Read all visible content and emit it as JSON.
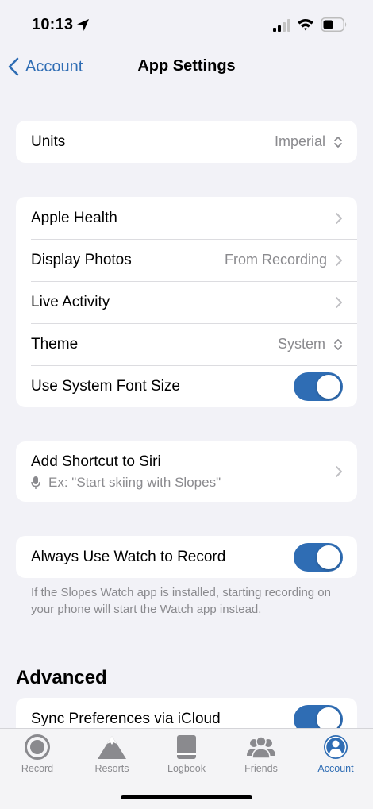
{
  "status_bar": {
    "time": "10:13"
  },
  "nav": {
    "back_label": "Account",
    "title": "App Settings"
  },
  "units": {
    "label": "Units",
    "value": "Imperial"
  },
  "general": {
    "apple_health": {
      "label": "Apple Health"
    },
    "display_photos": {
      "label": "Display Photos",
      "value": "From Recording"
    },
    "live_activity": {
      "label": "Live Activity"
    },
    "theme": {
      "label": "Theme",
      "value": "System"
    },
    "system_font": {
      "label": "Use System Font Size",
      "on": true
    }
  },
  "siri": {
    "title": "Add Shortcut to Siri",
    "example": "Ex: \"Start skiing with Slopes\""
  },
  "watch": {
    "label": "Always Use Watch to Record",
    "on": true,
    "footnote": "If the Slopes Watch app is installed, starting recording on your phone will start the Watch app instead."
  },
  "advanced": {
    "header": "Advanced",
    "sync": {
      "label": "Sync Preferences via iCloud",
      "on": true
    }
  },
  "tabs": [
    {
      "label": "Record",
      "icon": "record-icon",
      "active": false
    },
    {
      "label": "Resorts",
      "icon": "mountain-icon",
      "active": false
    },
    {
      "label": "Logbook",
      "icon": "book-icon",
      "active": false
    },
    {
      "label": "Friends",
      "icon": "friends-icon",
      "active": false
    },
    {
      "label": "Account",
      "icon": "account-icon",
      "active": true
    }
  ],
  "colors": {
    "accent": "#2f6db4",
    "background": "#f2f2f7",
    "secondary_text": "#8a8a8e"
  }
}
